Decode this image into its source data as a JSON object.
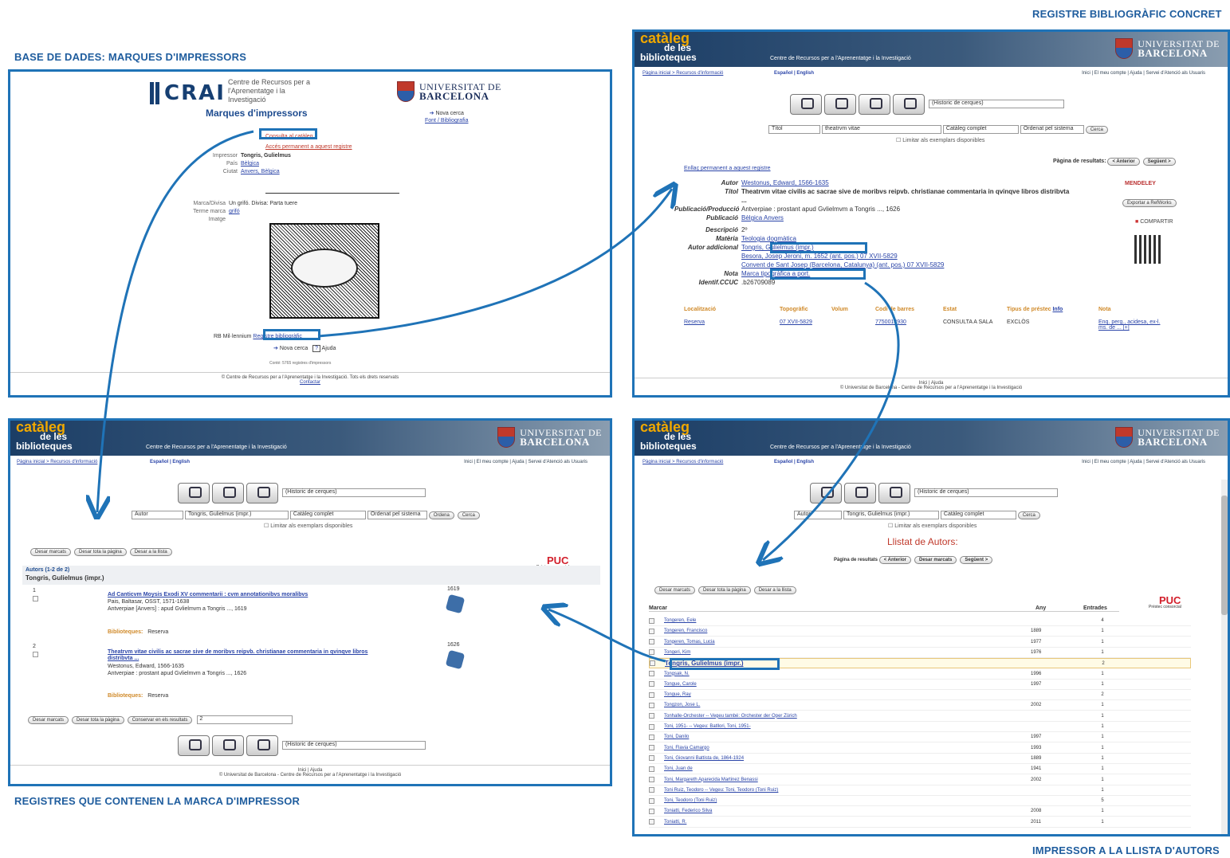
{
  "captions": {
    "top_left": "BASE DE DADES: MARQUES D'IMPRESSORS",
    "top_right": "REGISTRE BIBLIOGRÀFIC CONCRET",
    "bottom_left": "REGISTRES QUE CONTENEN LA MARCA D'IMPRESSOR",
    "bottom_right": "IMPRESSOR A LA LLISTA D'AUTORS"
  },
  "crai_panel": {
    "logo": "CRAI",
    "subtitle": "Centre de Recursos per a l'Aprenentatge i la Investigació",
    "ub_line1": "UNIVERSITAT DE",
    "ub_line2": "BARCELONA",
    "title": "Marques d'impressors",
    "new_search": "Nova cerca",
    "source": "Font / Bibliografia",
    "consult_link": "Consulta al catàleg",
    "permanent_link": "Accés permanent a aquest registre",
    "fields": [
      {
        "k": "Impressor",
        "v": "Tongris, Gulielmus"
      },
      {
        "k": "País",
        "v": "Bèlgica"
      },
      {
        "k": "Ciutat",
        "v": "Anvers, Bèlgica"
      }
    ],
    "fields2": [
      {
        "k": "Marca/Divisa",
        "v": "Un grifó. Divisa: Parta tuere"
      },
      {
        "k": "Terme marca",
        "v": "grifó"
      },
      {
        "k": "Imatge",
        "v": ""
      }
    ],
    "rb_label": "RB Mil·lennium",
    "rb_link": "Registre bibliogràfic",
    "new_search2": "Nova cerca",
    "help": "Ajuda",
    "count": "Conté: 5765 registres d'impressors",
    "footer": "© Centre de Recursos per a l'Aprenentatge i la Investigació. Tots els drets reservats",
    "footer_link": "Contactar"
  },
  "catalog_common": {
    "logo_1": "catàleg",
    "logo_2": "de les",
    "logo_3": "biblioteques",
    "subtitle": "Centre de Recursos per a l'Aprenentatge i la Investigació",
    "ub_line1": "UNIVERSITAT DE",
    "ub_line2": "BARCELONA",
    "breadcrumb": "Pàgina inicial > Recursos d'informació",
    "lang": "Español | English",
    "topnav": "Inici | El meu compte | Ajuda | Servei d'Atenció als Usuaris",
    "history": "(Historic de cerques)",
    "catalog_select": "Catàleg complet",
    "order_select": "Ordenat pel sistema",
    "search_btn": "Cerca",
    "limit": "Limitar als exemplars disponibles",
    "footer_nav": "Inici | Ajuda",
    "footer": "© Universitat de Barcelona - Centre de Recursos per a l'Aprenentatge i la Investigació"
  },
  "record_panel": {
    "search_field": "Títol",
    "search_value": "theatrvm vitae",
    "results_page": "Pàgina de resultats:",
    "prev": "< Anterior",
    "next": "Següent >",
    "permalink": "Enllaç permanent a aquest registre",
    "fields": [
      {
        "k": "Autor",
        "v": "Westonus, Edward, 1566-1635"
      },
      {
        "k": "Títol",
        "v": "Theatrvm vitae civilis ac sacrae sive de moribvs reipvb. christianae commentaria in qvinqve libros distribvta ..."
      },
      {
        "k": "Publicació/Producció",
        "v": "Antverpiae : prostant apud Gvlielmvm a Tongris ..., 1626"
      },
      {
        "k": "Publicació",
        "v": "Bèlgica Anvers"
      },
      {
        "k": "Descripció",
        "v": "2º"
      },
      {
        "k": "Matèria",
        "v": "Teologia dogmàtica"
      },
      {
        "k": "Autor addicional",
        "v": "Tongris, Gulielmus (impr.)"
      },
      {
        "k": "",
        "v": "Besora, Josep Jeroni, m. 1652 (ant. pos.) 07 XVII-5829"
      },
      {
        "k": "",
        "v": "Convent de Sant Josep (Barcelona, Catalunya) (ant. pos.) 07 XVII-5829"
      },
      {
        "k": "Nota",
        "v": "Marca tipogràfica a port."
      },
      {
        "k": "Identif.CCUC",
        "v": ".b26709089"
      }
    ],
    "holdings_headers": [
      "Localització",
      "Topogràfic",
      "Volum",
      "Codi de barres",
      "Estat",
      "Tipus de préstec",
      "Nota"
    ],
    "holdings_row": [
      "Reserva",
      "07 XVII-5829",
      "",
      "7750013930",
      "CONSULTA A SALA",
      "EXCLÒS",
      "Enq. perg., acidesa, ex-l. ms. de ... [+]"
    ],
    "info_link": "Info",
    "mendeley": "MENDELEY",
    "refworks": "Exportar a RefWorks",
    "share": "COMPARTIR"
  },
  "records_panel": {
    "search_field": "Autor",
    "search_value": "Tongris, Gulielmus (impr.)",
    "order_btn": "Ordena",
    "save_marked": "Desar marcats",
    "save_page": "Desar tota la pàgina",
    "save_list": "Desar a la llista",
    "heading": "Autors (1-2 de 2)",
    "author": "Tongris, Gulielmus (impr.)",
    "puc": "PUC",
    "puc_sub": "Préstec consorcial",
    "results": [
      {
        "n": "1",
        "title": "Ad Canticvm Moysis Exodi XV commentarii : cvm annotationibvs moralibvs",
        "author": "Pais, Baltasar, OSST, 1571-1638",
        "pub": "Antverpiae [Anvers] : apud Gvlielmvm a Tongris ..., 1619",
        "year": "1619",
        "lib_label": "Biblioteques:",
        "lib": "Reserva"
      },
      {
        "n": "2",
        "title": "Theatrvm vitae civilis ac sacrae sive de moribvs reipvb. christianae commentaria in qvinqve libros distribvta ...",
        "author": "Westonus, Edward, 1566-1635",
        "pub": "Antverpiae : prostant apud Gvlielmvm a Tongris ..., 1626",
        "year": "1626",
        "lib_label": "Biblioteques:",
        "lib": "Reserva"
      }
    ],
    "keep_label": "Conservar en els resultats",
    "keep_value": "2"
  },
  "authors_panel": {
    "list_title": "Llistat de Autors:",
    "results_page": "Pàgina de resultats",
    "prev": "< Anterior",
    "save_marked_mid": "Desar marcats",
    "next": "Següent >",
    "col_mark": "Marcar",
    "col_year": "Any",
    "col_entries": "Entrades",
    "rows": [
      {
        "name": "Tongeren, Eele",
        "year": "",
        "entries": "4"
      },
      {
        "name": "Tongeren, Francisco",
        "year": "1889",
        "entries": "1"
      },
      {
        "name": "Tongeren, Tomas, Lucia",
        "year": "1977",
        "entries": "1"
      },
      {
        "name": "Tongeri, Kim",
        "year": "1976",
        "entries": "1"
      },
      {
        "name": "Tongris, Gulielmus (impr.)",
        "year": "",
        "entries": "2"
      },
      {
        "name": "Tongsak, N.",
        "year": "1996",
        "entries": "1"
      },
      {
        "name": "Tongue, Carole",
        "year": "1997",
        "entries": "1"
      },
      {
        "name": "Tongue, Ray",
        "year": "",
        "entries": "2"
      },
      {
        "name": "Tongzon, Jose L.",
        "year": "2002",
        "entries": "1"
      },
      {
        "name": "Tonhalle-Orchester -- Vegeu també: Orchester der Oper Zürich",
        "year": "",
        "entries": "1"
      },
      {
        "name": "Toni, 1951- -- Vegeu: Batllori, Toni, 1951-",
        "year": "",
        "entries": "1"
      },
      {
        "name": "Toni, Danilo",
        "year": "1997",
        "entries": "1"
      },
      {
        "name": "Toni, Flavia Camargo",
        "year": "1993",
        "entries": "1"
      },
      {
        "name": "Toni, Giovanni Battista de, 1864-1924",
        "year": "1889",
        "entries": "1"
      },
      {
        "name": "Toni, Juan de",
        "year": "1941",
        "entries": "1"
      },
      {
        "name": "Toni, Margareth Aparecida Martinez Benassi",
        "year": "2002",
        "entries": "1"
      },
      {
        "name": "Toni Ruiz, Teodoro -- Vegeu: Toni, Teodoro (Toni Ruiz)",
        "year": "",
        "entries": "1"
      },
      {
        "name": "Toni, Teodoro (Toni Ruiz)",
        "year": "",
        "entries": "5"
      },
      {
        "name": "Toniatti, Federico Silva",
        "year": "2008",
        "entries": "1"
      },
      {
        "name": "Toniatti, R.",
        "year": "2011",
        "entries": "1"
      }
    ]
  }
}
